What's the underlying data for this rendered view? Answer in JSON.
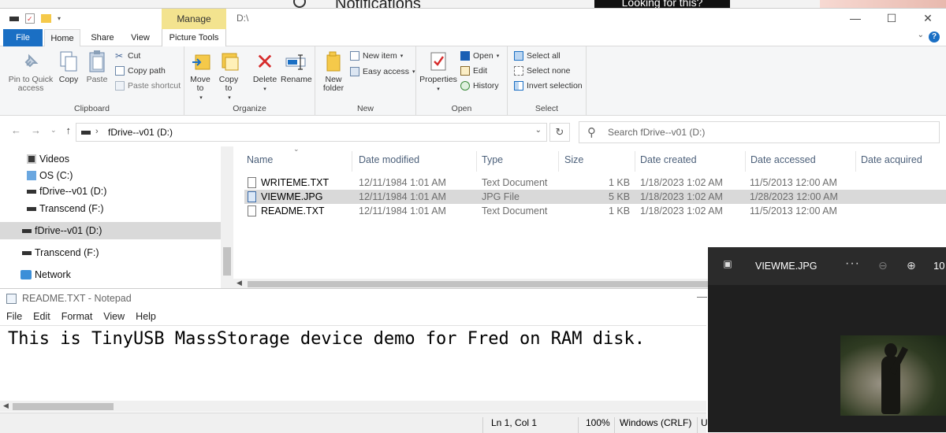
{
  "background": {
    "notifications_label": "Notifications",
    "looking_label": "Looking for this?"
  },
  "explorer": {
    "title_path": "D:\\",
    "manage_tab": "Manage",
    "tabs": [
      "File",
      "Home",
      "Share",
      "View",
      "Picture Tools"
    ],
    "ribbon": {
      "clipboard": {
        "label": "Clipboard",
        "pin": "Pin to Quick access",
        "copy": "Copy",
        "paste": "Paste",
        "cut": "Cut",
        "copy_path": "Copy path",
        "paste_shortcut": "Paste shortcut"
      },
      "organize": {
        "label": "Organize",
        "move_to": "Move to",
        "copy_to": "Copy to",
        "delete": "Delete",
        "rename": "Rename"
      },
      "new": {
        "label": "New",
        "new_folder": "New folder",
        "new_item": "New item",
        "easy_access": "Easy access"
      },
      "open": {
        "label": "Open",
        "properties": "Properties",
        "open": "Open",
        "edit": "Edit",
        "history": "History"
      },
      "select": {
        "label": "Select",
        "select_all": "Select all",
        "select_none": "Select none",
        "invert": "Invert selection"
      }
    },
    "address": "fDrive--v01 (D:)",
    "search_placeholder": "Search fDrive--v01 (D:)",
    "nav": [
      {
        "label": "Videos"
      },
      {
        "label": "OS (C:)"
      },
      {
        "label": "fDrive--v01 (D:)"
      },
      {
        "label": "Transcend (F:)"
      },
      {
        "label": "fDrive--v01 (D:)"
      },
      {
        "label": "Transcend (F:)"
      },
      {
        "label": "Network"
      }
    ],
    "columns": [
      "Name",
      "Date modified",
      "Type",
      "Size",
      "Date created",
      "Date accessed",
      "Date acquired"
    ],
    "files": [
      {
        "name": "WRITEME.TXT",
        "modified": "12/11/1984 1:01 AM",
        "type": "Text Document",
        "size": "1 KB",
        "created": "1/18/2023 1:02 AM",
        "accessed": "11/5/2013 12:00 AM"
      },
      {
        "name": "VIEWME.JPG",
        "modified": "12/11/1984 1:01 AM",
        "type": "JPG File",
        "size": "5 KB",
        "created": "1/18/2023 1:02 AM",
        "accessed": "1/28/2023 12:00 AM"
      },
      {
        "name": "README.TXT",
        "modified": "12/11/1984 1:01 AM",
        "type": "Text Document",
        "size": "1 KB",
        "created": "1/18/2023 1:02 AM",
        "accessed": "11/5/2013 12:00 AM"
      }
    ]
  },
  "notepad": {
    "title": "README.TXT - Notepad",
    "menu": [
      "File",
      "Edit",
      "Format",
      "View",
      "Help"
    ],
    "content": "This is TinyUSB MassStorage device demo for Fred on RAM disk.",
    "status": {
      "position": "Ln 1, Col 1",
      "zoom": "100%",
      "line_ending": "Windows (CRLF)",
      "encoding_partial": "U"
    }
  },
  "photos": {
    "title": "VIEWME.JPG",
    "more": "···",
    "zoom_partial": "10"
  }
}
